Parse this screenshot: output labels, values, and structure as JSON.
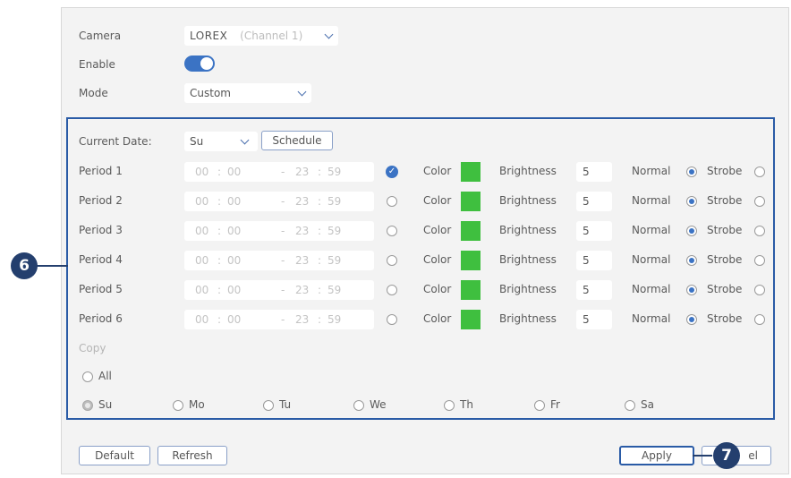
{
  "camera": {
    "label": "Camera",
    "brand": "LOREX",
    "channel": "(Channel 1)"
  },
  "enable": {
    "label": "Enable",
    "on": true
  },
  "mode": {
    "label": "Mode",
    "value": "Custom"
  },
  "current_date": {
    "label": "Current Date:",
    "value": "Su",
    "schedule_label": "Schedule"
  },
  "periods": [
    {
      "label": "Period 1",
      "start_h": "00",
      "start_m": "00",
      "end_h": "23",
      "end_m": "59",
      "selected": true,
      "color_label": "Color",
      "brightness_label": "Brightness",
      "brightness": "5",
      "normal_label": "Normal",
      "strobe_label": "Strobe"
    },
    {
      "label": "Period 2",
      "start_h": "00",
      "start_m": "00",
      "end_h": "23",
      "end_m": "59",
      "selected": false,
      "color_label": "Color",
      "brightness_label": "Brightness",
      "brightness": "5",
      "normal_label": "Normal",
      "strobe_label": "Strobe"
    },
    {
      "label": "Period 3",
      "start_h": "00",
      "start_m": "00",
      "end_h": "23",
      "end_m": "59",
      "selected": false,
      "color_label": "Color",
      "brightness_label": "Brightness",
      "brightness": "5",
      "normal_label": "Normal",
      "strobe_label": "Strobe"
    },
    {
      "label": "Period 4",
      "start_h": "00",
      "start_m": "00",
      "end_h": "23",
      "end_m": "59",
      "selected": false,
      "color_label": "Color",
      "brightness_label": "Brightness",
      "brightness": "5",
      "normal_label": "Normal",
      "strobe_label": "Strobe"
    },
    {
      "label": "Period 5",
      "start_h": "00",
      "start_m": "00",
      "end_h": "23",
      "end_m": "59",
      "selected": false,
      "color_label": "Color",
      "brightness_label": "Brightness",
      "brightness": "5",
      "normal_label": "Normal",
      "strobe_label": "Strobe"
    },
    {
      "label": "Period 6",
      "start_h": "00",
      "start_m": "00",
      "end_h": "23",
      "end_m": "59",
      "selected": false,
      "color_label": "Color",
      "brightness_label": "Brightness",
      "brightness": "5",
      "normal_label": "Normal",
      "strobe_label": "Strobe"
    }
  ],
  "time_sep": ":",
  "range_sep": "-",
  "copy": {
    "label": "Copy",
    "all_label": "All",
    "days": [
      "Su",
      "Mo",
      "Tu",
      "We",
      "Th",
      "Fr",
      "Sa"
    ]
  },
  "buttons": {
    "default": "Default",
    "refresh": "Refresh",
    "apply": "Apply",
    "cancel_visible": "el"
  },
  "callouts": {
    "six": "6",
    "seven": "7"
  },
  "colors": {
    "accent": "#3b73c4",
    "swatch": "#3fbf3f",
    "callout": "#243f6e"
  }
}
